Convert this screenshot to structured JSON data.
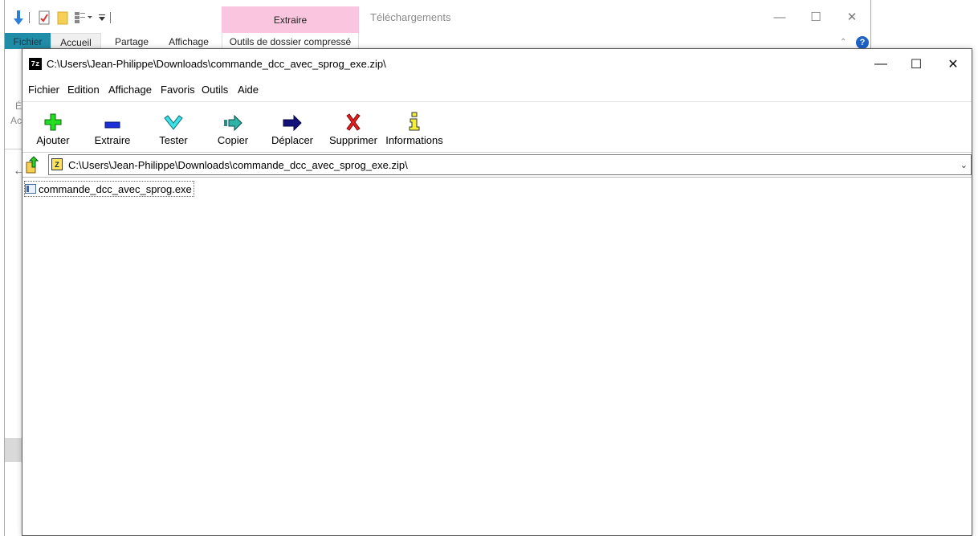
{
  "explorer": {
    "title": "Téléchargements",
    "context_tab": "Extraire",
    "context_tab_group": "Outils de dossier compressé",
    "ribbon_tabs": [
      "Fichier",
      "Accueil",
      "Partage",
      "Affichage"
    ],
    "left_partial_labels": [
      "É",
      "Ac"
    ],
    "help_label": "?"
  },
  "zip": {
    "title": "C:\\Users\\Jean-Philippe\\Downloads\\commande_dcc_avec_sprog_exe.zip\\",
    "app_icon_label": "7z",
    "menu": [
      "Fichier",
      "Edition",
      "Affichage",
      "Favoris",
      "Outils",
      "Aide"
    ],
    "toolbar": [
      {
        "label": "Ajouter",
        "icon": "plus-icon"
      },
      {
        "label": "Extraire",
        "icon": "minus-icon"
      },
      {
        "label": "Tester",
        "icon": "check-icon"
      },
      {
        "label": "Copier",
        "icon": "copy-arrow-icon"
      },
      {
        "label": "Déplacer",
        "icon": "move-arrow-icon"
      },
      {
        "label": "Supprimer",
        "icon": "delete-x-icon"
      },
      {
        "label": "Informations",
        "icon": "info-icon"
      }
    ],
    "address": "C:\\Users\\Jean-Philippe\\Downloads\\commande_dcc_avec_sprog_exe.zip\\",
    "files": [
      {
        "name": "commande_dcc_avec_sprog.exe"
      }
    ]
  },
  "colors": {
    "context_tab_bg": "#f9c5df",
    "file_tab_bg": "#1f8ca8",
    "help_blue": "#1e62c6"
  }
}
